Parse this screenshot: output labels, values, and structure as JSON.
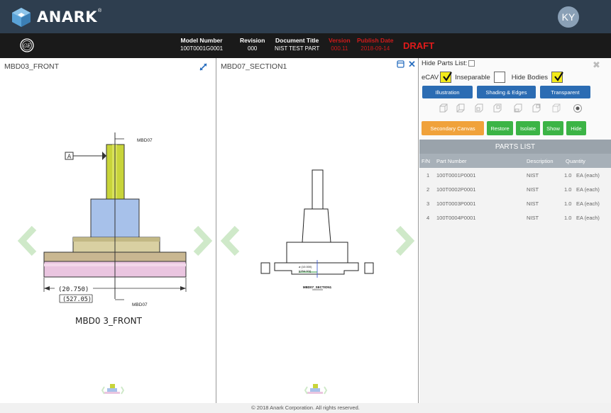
{
  "app": {
    "brand": "ANARK",
    "brand_mark": "®",
    "user_initials": "KY"
  },
  "infobar": {
    "model_label": "Model Number",
    "model_value": "100T0001G0001",
    "revision_label": "Revision",
    "revision_value": "000",
    "title_label": "Document Title",
    "title_value": "NIST TEST PART",
    "version_label": "Version",
    "version_value": "000.11",
    "publish_label": "Publish Date",
    "publish_value": "2018-09-14",
    "status": "DRAFT"
  },
  "left_view": {
    "title": "MBD03_FRONT",
    "caption": "MBD0 3_FRONT",
    "datum_label": "A",
    "ref_top": "MBD07",
    "ref_bottom": "MBD07",
    "dim_value": "(20.750)",
    "dim_metric": "(527.05)"
  },
  "mid_view": {
    "title": "MBD07_SECTION1",
    "section_label": "MBD07_SECTION1",
    "dim_small_1": "ø (10.000)",
    "dim_small_2": "[(254.00)]"
  },
  "right_panel": {
    "hide_parts_label": "Hide Parts List:",
    "ecav_label": "eCAV",
    "ecav_checked": true,
    "inseparable_label": "Inseparable",
    "inseparable_checked": false,
    "hide_bodies_label": "Hide Bodies",
    "hide_bodies_checked": true,
    "btn_illustration": "Illustration",
    "btn_shading": "Shading & Edges",
    "btn_transparent": "Transparent",
    "btn_secondary": "Secondary Canvas",
    "btn_restore": "Restore",
    "btn_isolate": "Isolate",
    "btn_show": "Show",
    "btn_hide": "Hide",
    "view_icons": [
      "view-front-icon",
      "view-back-icon",
      "view-left-icon",
      "view-right-icon",
      "view-top-icon",
      "view-bottom-icon",
      "view-iso-icon",
      "view-default-icon"
    ]
  },
  "parts_list": {
    "title": "PARTS LIST",
    "columns": {
      "fn": "F/N",
      "part": "Part Number",
      "desc": "Description",
      "qty": "Quantity"
    },
    "rows": [
      {
        "fn": "1",
        "part": "100T0001P0001",
        "desc": "NIST",
        "qty": "1.0",
        "unit": "EA (each)"
      },
      {
        "fn": "2",
        "part": "100T0002P0001",
        "desc": "NIST",
        "qty": "1.0",
        "unit": "EA (each)"
      },
      {
        "fn": "3",
        "part": "100T0003P0001",
        "desc": "NIST",
        "qty": "1.0",
        "unit": "EA (each)"
      },
      {
        "fn": "4",
        "part": "100T0004P0001",
        "desc": "NIST",
        "qty": "1.0",
        "unit": "EA (each)"
      }
    ]
  },
  "footer": {
    "copyright": "© 2018 Anark Corporation. All rights reserved."
  },
  "colors": {
    "topbar": "#2e3e4f",
    "infobar": "#1a1a1a",
    "accent_blue": "#2b6cb3",
    "accent_orange": "#f0a23b",
    "accent_green": "#3cb446",
    "draft_red": "#e01a1a",
    "nav_arrow": "#c8e6c9"
  }
}
